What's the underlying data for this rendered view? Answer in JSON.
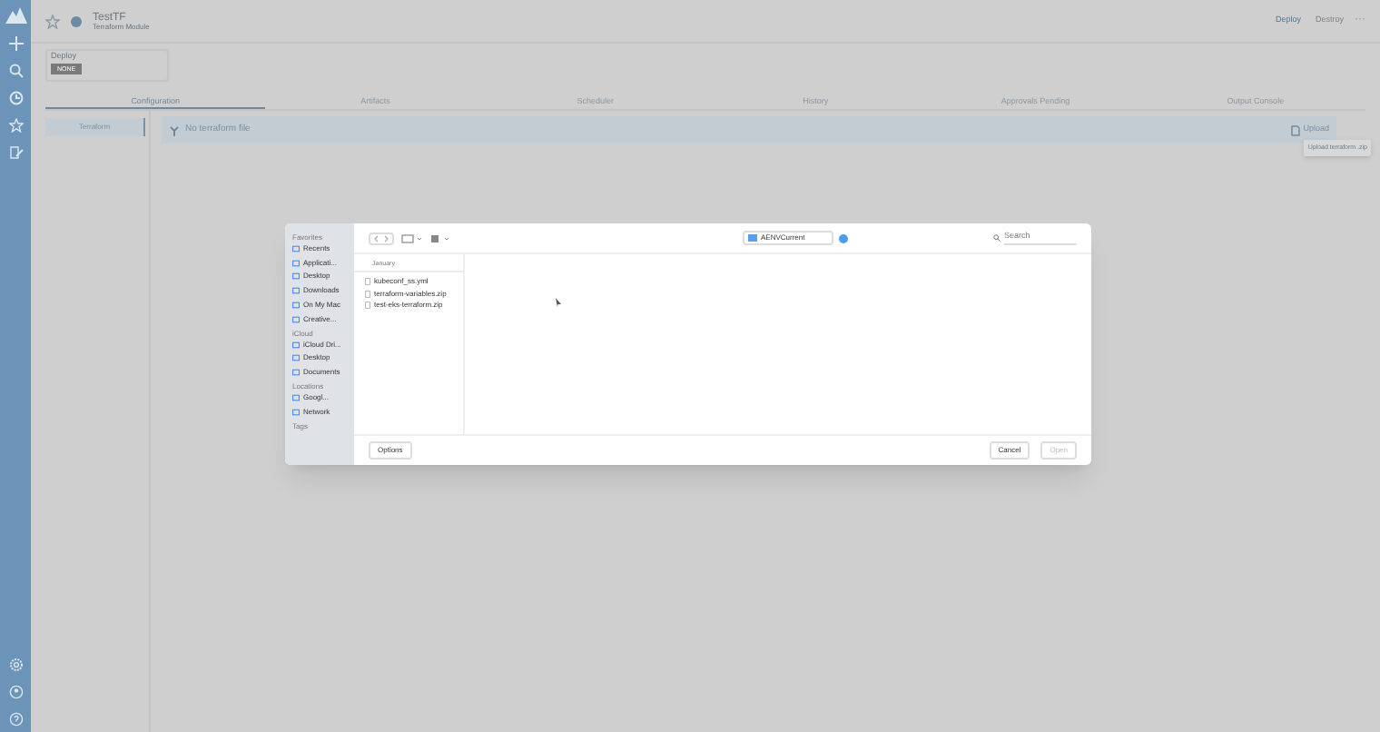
{
  "header": {
    "title": "TestTF",
    "subtitle": "Terraform Module",
    "actions": [
      {
        "label": "Deploy",
        "disabled": false
      },
      {
        "label": "Destroy",
        "disabled": true
      }
    ],
    "more": "···"
  },
  "deploy_box": {
    "label": "Deploy",
    "badge": "NONE"
  },
  "tabs": [
    {
      "label": "Configuration",
      "selected": true
    },
    {
      "label": "Artifacts",
      "selected": false
    },
    {
      "label": "Scheduler",
      "selected": false
    },
    {
      "label": "History",
      "selected": false
    },
    {
      "label": "Approvals Pending",
      "selected": false
    },
    {
      "label": "Output Console",
      "selected": false
    }
  ],
  "side_nav": [
    {
      "label": "Terraform",
      "selected": true
    }
  ],
  "banner": {
    "message": "No terraform file",
    "button": "Upload",
    "tooltip": "Upload terraform .zip"
  },
  "dialog": {
    "sidebar": [
      {
        "heading": "Favorites",
        "items": [
          "Recents",
          "Applicati...",
          "Desktop",
          "Downloads",
          "On My Mac",
          "Creative..."
        ]
      },
      {
        "heading": "iCloud",
        "items": [
          "iCloud Dri...",
          "Desktop",
          "Documents"
        ]
      },
      {
        "heading": "Locations",
        "items": [
          "Googl...",
          "Network"
        ]
      },
      {
        "heading": "Tags"
      }
    ],
    "folder": "AENVCurrent",
    "search": {
      "placeholder": "Search"
    },
    "column_header": "January",
    "files": [
      {
        "name": "kubeconf_ss.yml",
        "selected": false
      },
      {
        "name": "terraform-variables.zip",
        "selected": false
      },
      {
        "name": "test-eks-terraform.zip",
        "selected": false
      }
    ],
    "buttons": [
      {
        "label": "Options",
        "disabled": false
      },
      {
        "label": "Cancel",
        "disabled": false
      },
      {
        "label": "Open",
        "disabled": true
      }
    ]
  }
}
